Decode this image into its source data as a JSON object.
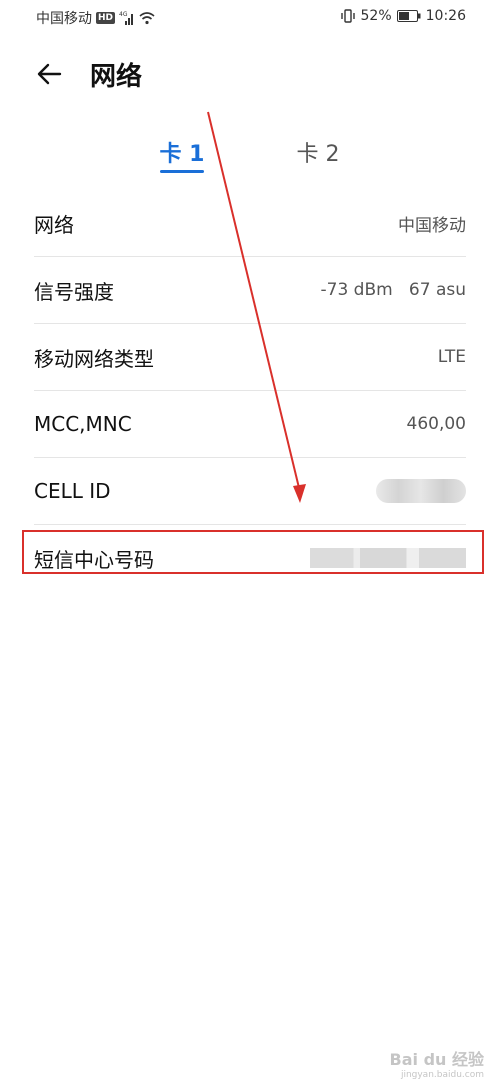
{
  "status_bar": {
    "carrier": "中国移动",
    "hd_badge": "HD",
    "network_tag": "4G",
    "battery_percent": "52%",
    "time": "10:26",
    "icons": [
      "signal-icon",
      "wifi-icon",
      "vibrate-icon",
      "battery-icon"
    ]
  },
  "header": {
    "title": "网络",
    "back_icon": "arrow-left-icon"
  },
  "tabs": [
    {
      "label": "卡 1",
      "active": true
    },
    {
      "label": "卡 2",
      "active": false
    }
  ],
  "rows": [
    {
      "label": "网络",
      "value": "中国移动"
    },
    {
      "label": "信号强度",
      "value": "-73 dBm   67 asu"
    },
    {
      "label": "移动网络类型",
      "value": "LTE"
    },
    {
      "label": "MCC,MNC",
      "value": "460,00"
    },
    {
      "label": "CELL ID",
      "value": ""
    },
    {
      "label": "短信中心号码",
      "value": ""
    }
  ],
  "colors": {
    "accent": "#1a6fd8",
    "annotation": "#d9302b"
  },
  "watermark": {
    "brand": "Bai du 经验",
    "url": "jingyan.baidu.com"
  }
}
